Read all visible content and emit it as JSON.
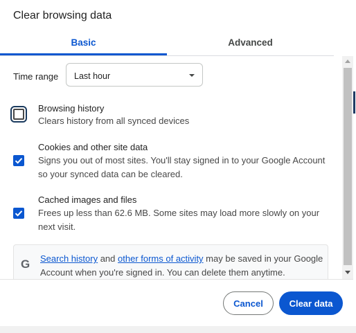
{
  "dialog": {
    "title": "Clear browsing data"
  },
  "tabs": [
    {
      "label": "Basic",
      "active": true
    },
    {
      "label": "Advanced",
      "active": false
    }
  ],
  "time_range": {
    "label": "Time range",
    "selected": "Last hour"
  },
  "options": [
    {
      "title": "Browsing history",
      "description": "Clears history from all synced devices",
      "checked": false
    },
    {
      "title": "Cookies and other site data",
      "description": "Signs you out of most sites. You'll stay signed in to your Google Account so your synced data can be cleared.",
      "checked": true
    },
    {
      "title": "Cached images and files",
      "description": "Frees up less than 62.6 MB. Some sites may load more slowly on your next visit.",
      "checked": true
    }
  ],
  "info": {
    "icon": "google-g-icon",
    "link1": "Search history",
    "text1": " and ",
    "link2": "other forms of activity",
    "text2": " may be saved in your Google Account when you're signed in. You can delete them anytime."
  },
  "buttons": {
    "cancel": "Cancel",
    "clear": "Clear data"
  },
  "colors": {
    "accent": "#0b57d0",
    "text": "#1f1f1f",
    "secondary_text": "#474747"
  }
}
